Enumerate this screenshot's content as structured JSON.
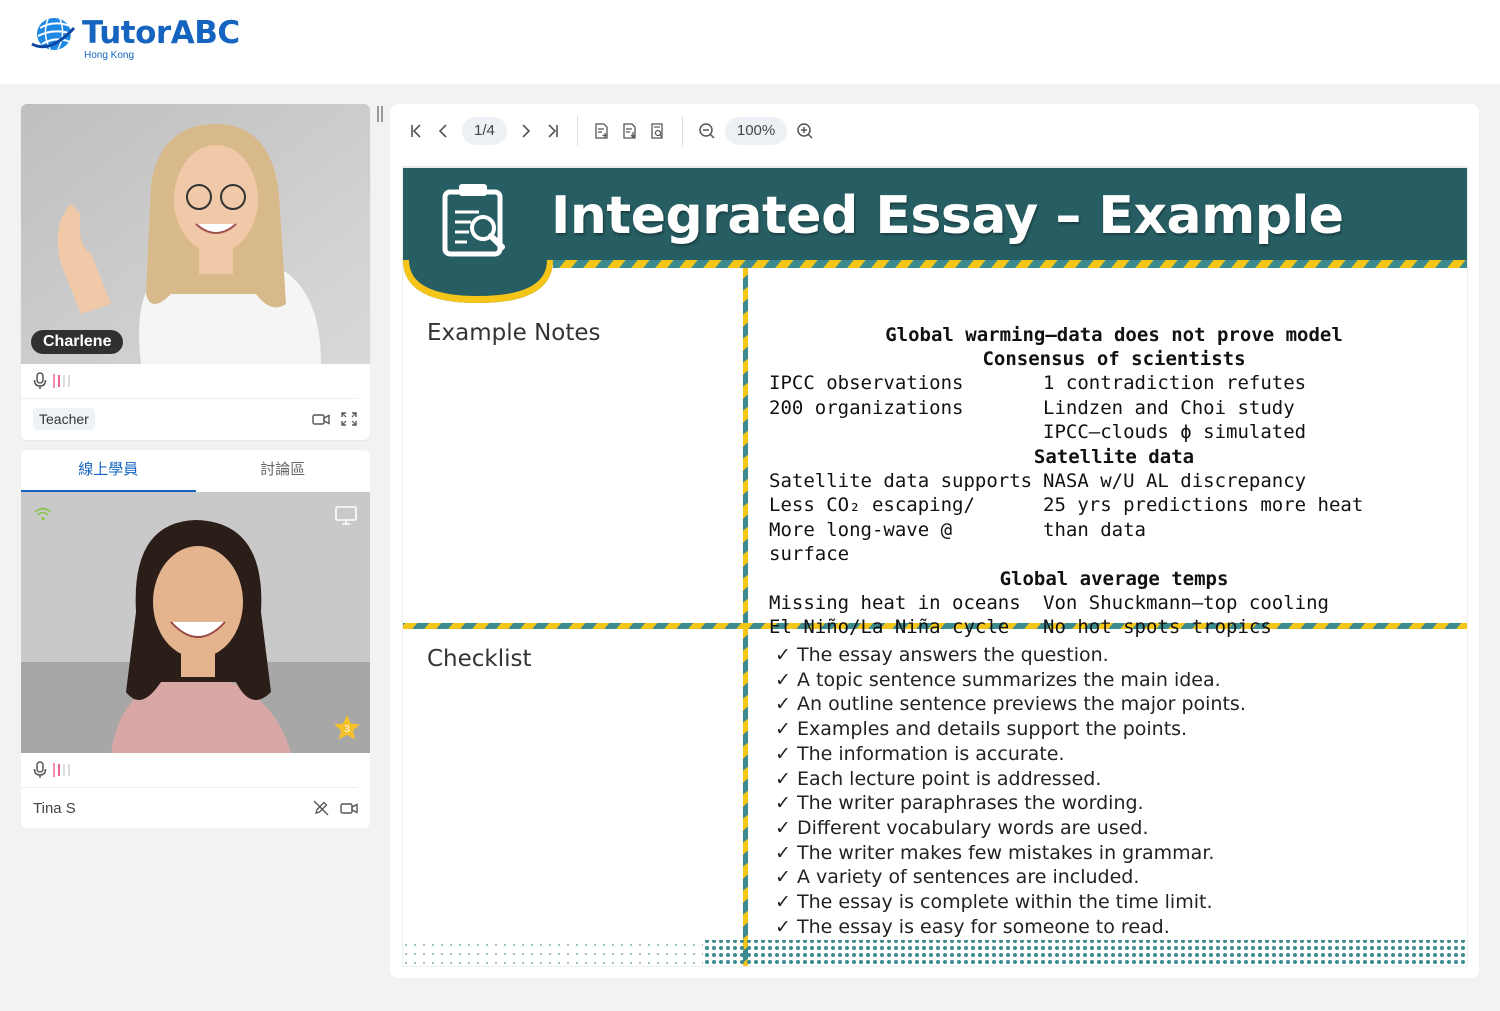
{
  "header": {
    "brand": "TutorABC",
    "region": "Hong Kong"
  },
  "teacher": {
    "name": "Charlene",
    "role": "Teacher",
    "video_icons": [
      "camera-icon",
      "fullscreen-icon"
    ]
  },
  "students_panel": {
    "tabs": [
      {
        "label": "線上學員",
        "active": true
      },
      {
        "label": "討論區",
        "active": false
      }
    ],
    "students": [
      {
        "name": "Tina S",
        "star_count": "3"
      }
    ]
  },
  "toolbar": {
    "page": "1/4",
    "zoom": "100%"
  },
  "slide": {
    "title": "Integrated Essay – Example",
    "notes_label": "Example Notes",
    "checklist_label": "Checklist",
    "notes": [
      {
        "type": "head",
        "text": "Global warming—data does not prove model"
      },
      {
        "type": "head",
        "text": "Consensus of scientists"
      },
      {
        "type": "row",
        "left": "IPCC observations",
        "right": "1 contradiction refutes"
      },
      {
        "type": "row",
        "left": "200 organizations",
        "right": "Lindzen and Choi study"
      },
      {
        "type": "row",
        "left": "",
        "right": "IPCC—clouds ϕ simulated"
      },
      {
        "type": "head",
        "text": "Satellite data"
      },
      {
        "type": "row",
        "left": "Satellite data supports",
        "right": "NASA w/U AL discrepancy"
      },
      {
        "type": "row",
        "left": "Less CO₂ escaping/",
        "right": "25 yrs predictions more heat"
      },
      {
        "type": "row",
        "left": "More long-wave @ surface",
        "right": "than data"
      },
      {
        "type": "head",
        "text": "Global average temps"
      },
      {
        "type": "row",
        "left": "Missing heat in oceans",
        "right": "Von Shuckmann—top cooling"
      },
      {
        "type": "row",
        "left": "El Niño/La Niña cycle",
        "right": "No hot spots tropics"
      }
    ],
    "checklist": [
      "The essay answers the question.",
      "A topic sentence summarizes the main idea.",
      "An outline sentence previews the major points.",
      "Examples and details support the points.",
      "The information is accurate.",
      "Each lecture point is addressed.",
      "The writer paraphrases the wording.",
      "Different vocabulary words are used.",
      "The writer makes few mistakes in grammar.",
      "A variety of sentences are included.",
      "The essay is complete within the time limit.",
      "The essay is easy for someone to read."
    ],
    "colors": {
      "banner": "#265e63",
      "stripe_yellow": "#f5c518",
      "divider_teal": "#3b8a8f",
      "brand_blue": "#1565c0"
    }
  }
}
